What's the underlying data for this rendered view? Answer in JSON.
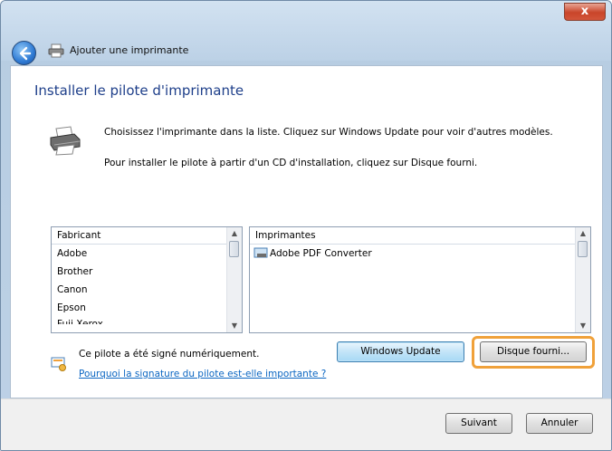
{
  "window": {
    "title": "Ajouter une imprimante",
    "close_label": "x"
  },
  "content": {
    "heading": "Installer le pilote d'imprimante",
    "description_1": "Choisissez l'imprimante dans la liste. Cliquez sur Windows Update pour voir d'autres modèles.",
    "description_2": "Pour installer le pilote à partir d'un CD d'installation, cliquez sur Disque fourni."
  },
  "manufacturer_list": {
    "header": "Fabricant",
    "items": [
      "Adobe",
      "Brother",
      "Canon",
      "Epson",
      "Fuji Xerox"
    ]
  },
  "printer_list": {
    "header": "Imprimantes",
    "items": [
      "Adobe PDF Converter"
    ]
  },
  "signature": {
    "status_text": "Ce pilote a été signé numériquement.",
    "link_text": "Pourquoi la signature du pilote est-elle importante ?"
  },
  "buttons": {
    "windows_update": "Windows Update",
    "disk": "Disque fourni...",
    "next": "Suivant",
    "cancel": "Annuler"
  },
  "colors": {
    "highlight": "#f0a13a",
    "heading": "#1e3f8a",
    "link": "#0b66c2"
  }
}
